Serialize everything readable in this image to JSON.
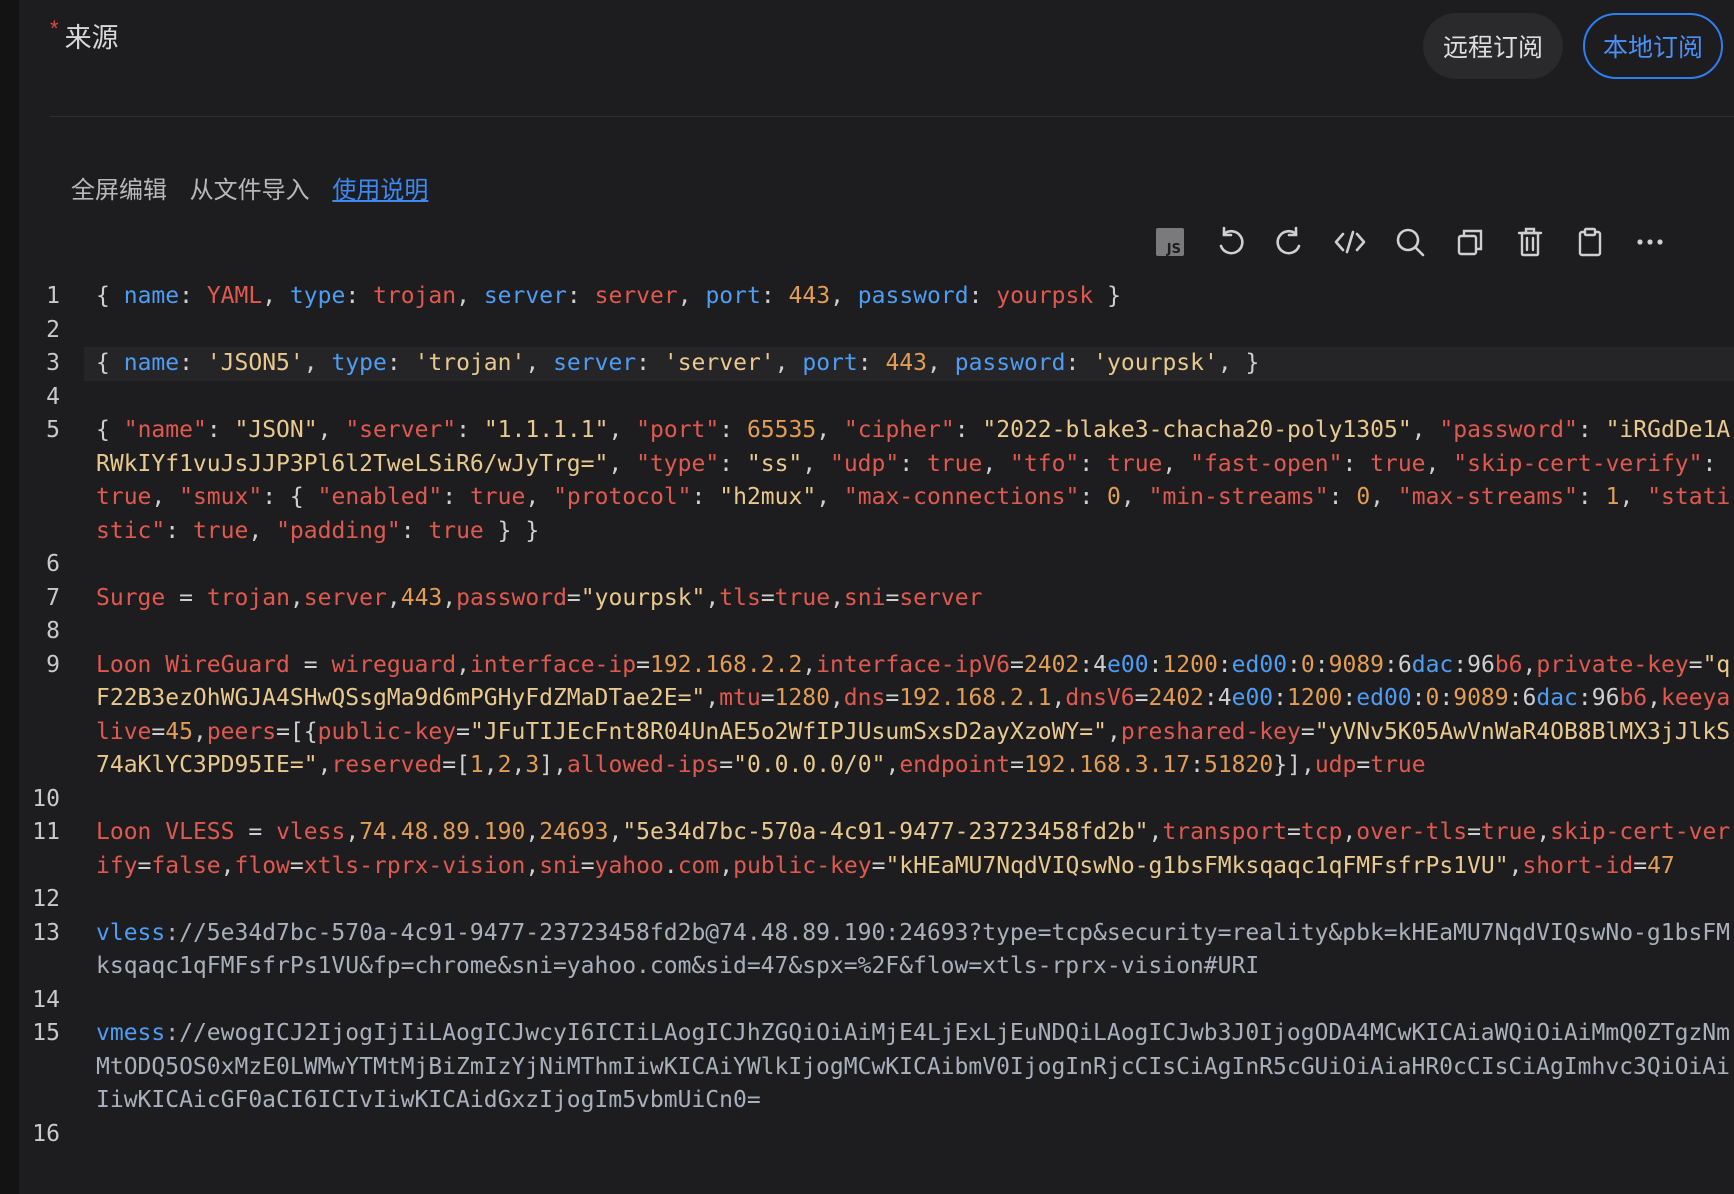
{
  "source": {
    "required_mark": "*",
    "label": "来源"
  },
  "segmented": {
    "remote": "远程订阅",
    "local": "本地订阅"
  },
  "links": {
    "fullscreen": "全屏编辑",
    "import": "从文件导入",
    "help": "使用说明"
  },
  "toolbar": {
    "icons": [
      "js-icon",
      "undo-icon",
      "redo-icon",
      "code-icon",
      "search-icon",
      "copy-icon",
      "trash-icon",
      "clipboard-icon",
      "more-icon"
    ],
    "js_label": "JS"
  },
  "editor": {
    "active_line": 3,
    "lines": [
      "{ name: YAML, type: trojan, server: server, port: 443, password: yourpsk }",
      "",
      "{ name: 'JSON5', type: 'trojan', server: 'server', port: 443, password: 'yourpsk', }",
      "",
      "{ \"name\": \"JSON\", \"server\": \"1.1.1.1\", \"port\": 65535, \"cipher\": \"2022-blake3-chacha20-poly1305\", \"password\": \"iRGdDe1ARWkIYf1vuJsJJP3Pl6l2TweLSiR6/wJyTrg=\", \"type\": \"ss\", \"udp\": true, \"tfo\": true, \"fast-open\": true, \"skip-cert-verify\": true, \"smux\": { \"enabled\": true, \"protocol\": \"h2mux\", \"max-connections\": 0, \"min-streams\": 0, \"max-streams\": 1, \"statistic\": true, \"padding\": true } }",
      "",
      "Surge = trojan,server,443,password=\"yourpsk\",tls=true,sni=server",
      "",
      "Loon WireGuard = wireguard,interface-ip=192.168.2.2,interface-ipV6=2402:4e00:1200:ed00:0:9089:6dac:96b6,private-key=\"qF22B3ezOhWGJA4SHwQSsgMa9d6mPGHyFdZMaDTae2E=\",mtu=1280,dns=192.168.2.1,dnsV6=2402:4e00:1200:ed00:0:9089:6dac:96b6,keeyalive=45,peers=[{public-key=\"JFuTIJEcFnt8R04UnAE5o2WfIPJUsumSxsD2ayXzoWY=\",preshared-key=\"yVNv5K05AwVnWaR4OB8BlMX3jJlkS74aKlYC3PD95IE=\",reserved=[1,2,3],allowed-ips=\"0.0.0.0/0\",endpoint=192.168.3.17:51820}],udp=true",
      "",
      "Loon VLESS = vless,74.48.89.190,24693,\"5e34d7bc-570a-4c91-9477-23723458fd2b\",transport=tcp,over-tls=true,skip-cert-verify=false,flow=xtls-rprx-vision,sni=yahoo.com,public-key=\"kHEaMU7NqdVIQswNo-g1bsFMksqaqc1qFMFsfrPs1VU\",short-id=47",
      "",
      "vless://5e34d7bc-570a-4c91-9477-23723458fd2b@74.48.89.190:24693?type=tcp&security=reality&pbk=kHEaMU7NqdVIQswNo-g1bsFMksqaqc1qFMFsfrPs1VU&fp=chrome&sni=yahoo.com&sid=47&spx=%2F&flow=xtls-rprx-vision#URI",
      "",
      "vmess://ewogICJ2IjogIjIiLAogICJwcyI6ICIiLAogICJhZGQiOiAiMjE4LjExLjEuNDQiLAogICJwb3J0IjogODA4MCwKICAiaWQiOiAiMmQ0ZTgzNmMtODQ5OS0xMzE0LWMwYTMtMjBiZmIzYjNiMThmIiwKICAiYWlkIjogMCwKICAibmV0IjogInRjcCIsCiAgInR5cGUiOiAiaHR0cCIsCiAgImhvc3QiOiAiIiwKICAicGF0aCI6ICIvIiwKICAidGxzIjogIm5vbmUiCn0=",
      ""
    ]
  }
}
